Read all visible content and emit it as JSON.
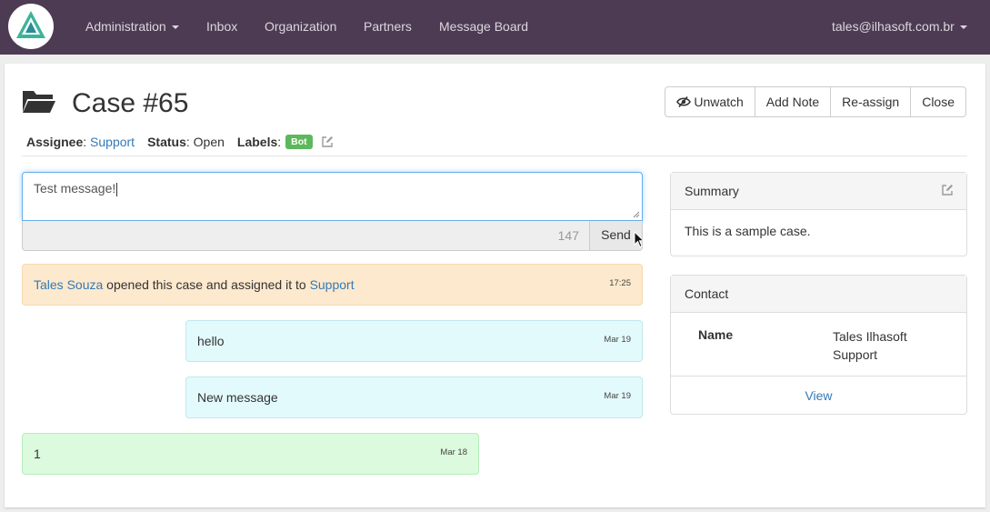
{
  "navbar": {
    "logo_icon": "triangle-logo-icon",
    "items": [
      {
        "label": "Administration",
        "dropdown": true
      },
      {
        "label": "Inbox"
      },
      {
        "label": "Organization"
      },
      {
        "label": "Partners"
      },
      {
        "label": "Message Board"
      }
    ],
    "user": "tales@ilhasoft.com.br"
  },
  "case": {
    "icon": "folder-open-icon",
    "title": "Case #65",
    "actions": {
      "unwatch": "Unwatch",
      "unwatch_icon": "eye-slash-icon",
      "add_note": "Add Note",
      "reassign": "Re-assign",
      "close": "Close"
    },
    "meta": {
      "assignee_label": "Assignee",
      "assignee": "Support",
      "status_label": "Status",
      "status": "Open",
      "labels_label": "Labels",
      "label_badge": "Bot",
      "edit_icon": "edit-icon"
    }
  },
  "composer": {
    "value": "Test message!",
    "counter": "147",
    "send_label": "Send"
  },
  "timeline": {
    "action": {
      "user": "Tales Souza",
      "text": "opened this case and assigned it to",
      "target": "Support",
      "time": "17:25"
    },
    "messages": [
      {
        "text": "hello",
        "time": "Mar 19",
        "direction": "out"
      },
      {
        "text": "New message",
        "time": "Mar 19",
        "direction": "out"
      },
      {
        "text": "1",
        "time": "Mar 18",
        "direction": "in"
      }
    ]
  },
  "summary": {
    "heading": "Summary",
    "body": "This is a sample case."
  },
  "contact": {
    "heading": "Contact",
    "name_label": "Name",
    "name_value": "Tales Ilhasoft Support",
    "view_link": "View"
  },
  "colors": {
    "navbar_bg": "#4d3b53",
    "link": "#337ab7",
    "label_green": "#5cb85c",
    "action_bg": "#fde9cd",
    "outgoing_bg": "#e3fafc",
    "incoming_bg": "#dcfadd"
  }
}
